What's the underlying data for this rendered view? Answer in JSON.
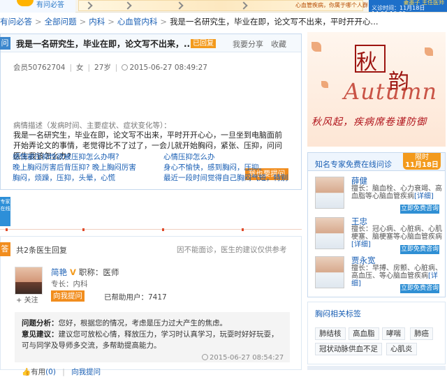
{
  "banner": {
    "logo_text": "有问必答",
    "ad_text": "心血管疾病，你属于哪个人群",
    "right_top": "妻墨子 主任医师",
    "right_bottom": "义诊时间：11月18日 14:00-16:00"
  },
  "breadcrumb": {
    "items": [
      "有问必答",
      "全部问题",
      "内科",
      "心血管内科"
    ],
    "current": "我是一名研究生，毕业在即，论文写不出来，平时开开心..."
  },
  "question": {
    "tag": "问",
    "title": "我是一名研究生，毕业在即，论文写不出来，...",
    "status": "已回复",
    "share_label": "我要分享",
    "favorite_label": "收藏",
    "user": "会员50762704",
    "gender": "女",
    "age": "27岁",
    "time": "2015-06-27 08:49:27",
    "desc_label": "病情描述（发病时间、主要症状、症状变化等）：",
    "desc": "我是一名研究生，毕业在即，论文写不出来，平时开开心心，一旦坐到电脑面前开始弄论文的事情，老觉得比不了过了，一会儿就开始胸闷，紧张、压抑，问问医生我该怎么办?",
    "me_too": "我也要提问",
    "related": [
      "感情被压抑性欲被压抑怎么办啊?",
      "心情压抑怎么办",
      "晚上胸闷厉害后背压抑? 晚上胸闷厉害",
      "身心不愉快，感到胸闷，压抑。",
      "胸闷，烦躁，压抑，头晕，心慌",
      "最近一段时间觉得自己胸闷气短，特别"
    ]
  },
  "side_tab": "专家在线",
  "answers": {
    "tag": "答",
    "count": "共2条医生回复",
    "notice": "因不能面诊，医生的建议仅供参考",
    "doctor": {
      "name": "简艳",
      "title_label": "职称：",
      "title": "医师",
      "specialty": "专长：内科",
      "follow": "关注",
      "ask_me": "向我提问",
      "helped": "已帮助用户：7417"
    },
    "analysis_label": "问题分析：",
    "analysis": "您好，根据您的情况，考虑是压力过大产生的焦虑。",
    "advice_label": "意见建议：",
    "advice": "建议您可放松心情，释放压力，学习时认真学习，玩耍时好好玩耍，可与同学及导师多交流，多帮助提高能力。",
    "time": "2015-06-27 08:54:27",
    "useful_label": "有用",
    "useful_count": "(0)",
    "thanks_label": "向我提问"
  },
  "autumn_ad": {
    "char1": "秋",
    "char2": "韵",
    "english": "Autumn",
    "slogan": "秋风起，疾病席卷谨防御"
  },
  "experts": {
    "title": "知名专家免费在线问诊",
    "limited_top": "限时",
    "limited_date": "11月18日",
    "consult_label": "立即免费咨询",
    "list": [
      {
        "name": "薛健",
        "skill": "擅长：脑血栓、心力衰竭、高血脂等心脑血管疾病",
        "detail": "[详细]"
      },
      {
        "name": "王忠",
        "skill": "擅长：冠心病、心脏病、心肌梗塞、脑梗塞等心脑血管疾病",
        "detail": "[详细]"
      },
      {
        "name": "贾永宽",
        "skill": "擅长：早搏、房颤、心脏病、高血压、等心脑血管疾病",
        "detail": "[详细]"
      }
    ]
  },
  "tags": {
    "title": "胸闷相关标签",
    "items": [
      "肺结核",
      "高血脂",
      "哮喘",
      "肺癌",
      "冠状动脉供血不足",
      "心肌炎"
    ]
  }
}
